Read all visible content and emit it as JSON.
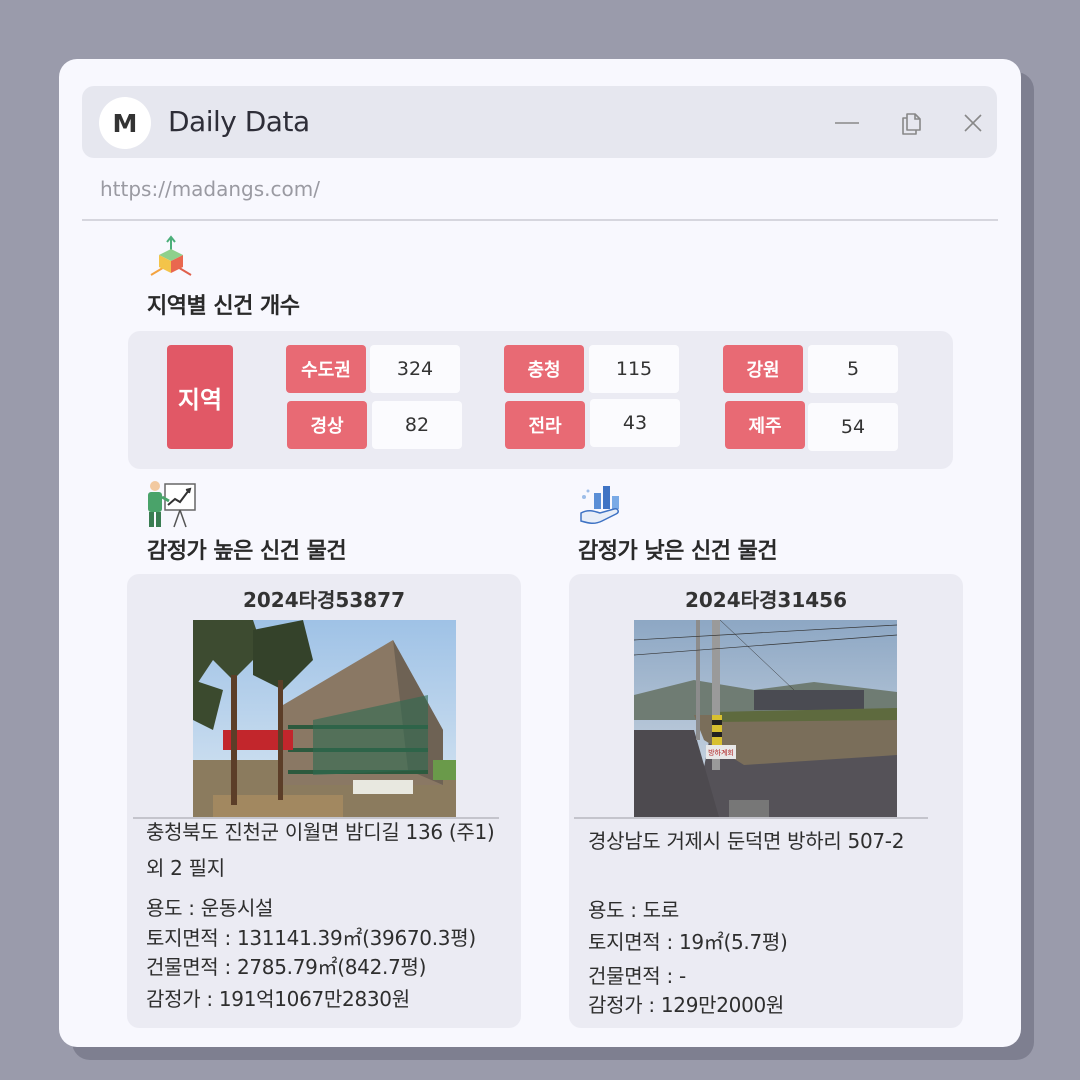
{
  "window": {
    "avatar_letter": "M",
    "title": "Daily Data",
    "url": "https://madangs.com/"
  },
  "region_section": {
    "icon": "3d-axes-icon",
    "title": "지역별 신건 개수",
    "label": "지역",
    "regions": [
      {
        "name": "수도권",
        "count": "324"
      },
      {
        "name": "충청",
        "count": "115"
      },
      {
        "name": "강원",
        "count": "5"
      },
      {
        "name": "경상",
        "count": "82"
      },
      {
        "name": "전라",
        "count": "43"
      },
      {
        "name": "제주",
        "count": "54"
      }
    ]
  },
  "high_section": {
    "icon": "presentation-chart-icon",
    "title": "감정가 높은 신건 물건",
    "case_no": "2024타경53877",
    "address": "충청북도 진천군 이월면 밤디길 136 (주1) 외 2 필지",
    "usage": "용도 : 운동시설",
    "land_area": "토지면적 : 131141.39㎡(39670.3평)",
    "building_area": "건물면적 : 2785.79㎡(842.7평)",
    "appraisal": "감정가 : 191억1067만2830원"
  },
  "low_section": {
    "icon": "hand-bar-chart-icon",
    "title": "감정가 낮은 신건 물건",
    "case_no": "2024타경31456",
    "address": "경상남도 거제시 둔덕면 방하리 507-2",
    "usage": "용도 : 도로",
    "land_area": "토지면적 : 19㎡(5.7평)",
    "building_area": "건물면적 : -",
    "appraisal": "감정가 : 129만2000원",
    "sign_text": "방하계회"
  },
  "colors": {
    "accent": "#e15866",
    "chip": "#e86a74",
    "card": "#ebebf3",
    "window": "#f8f8fe",
    "backdrop": "#9a9bab"
  }
}
